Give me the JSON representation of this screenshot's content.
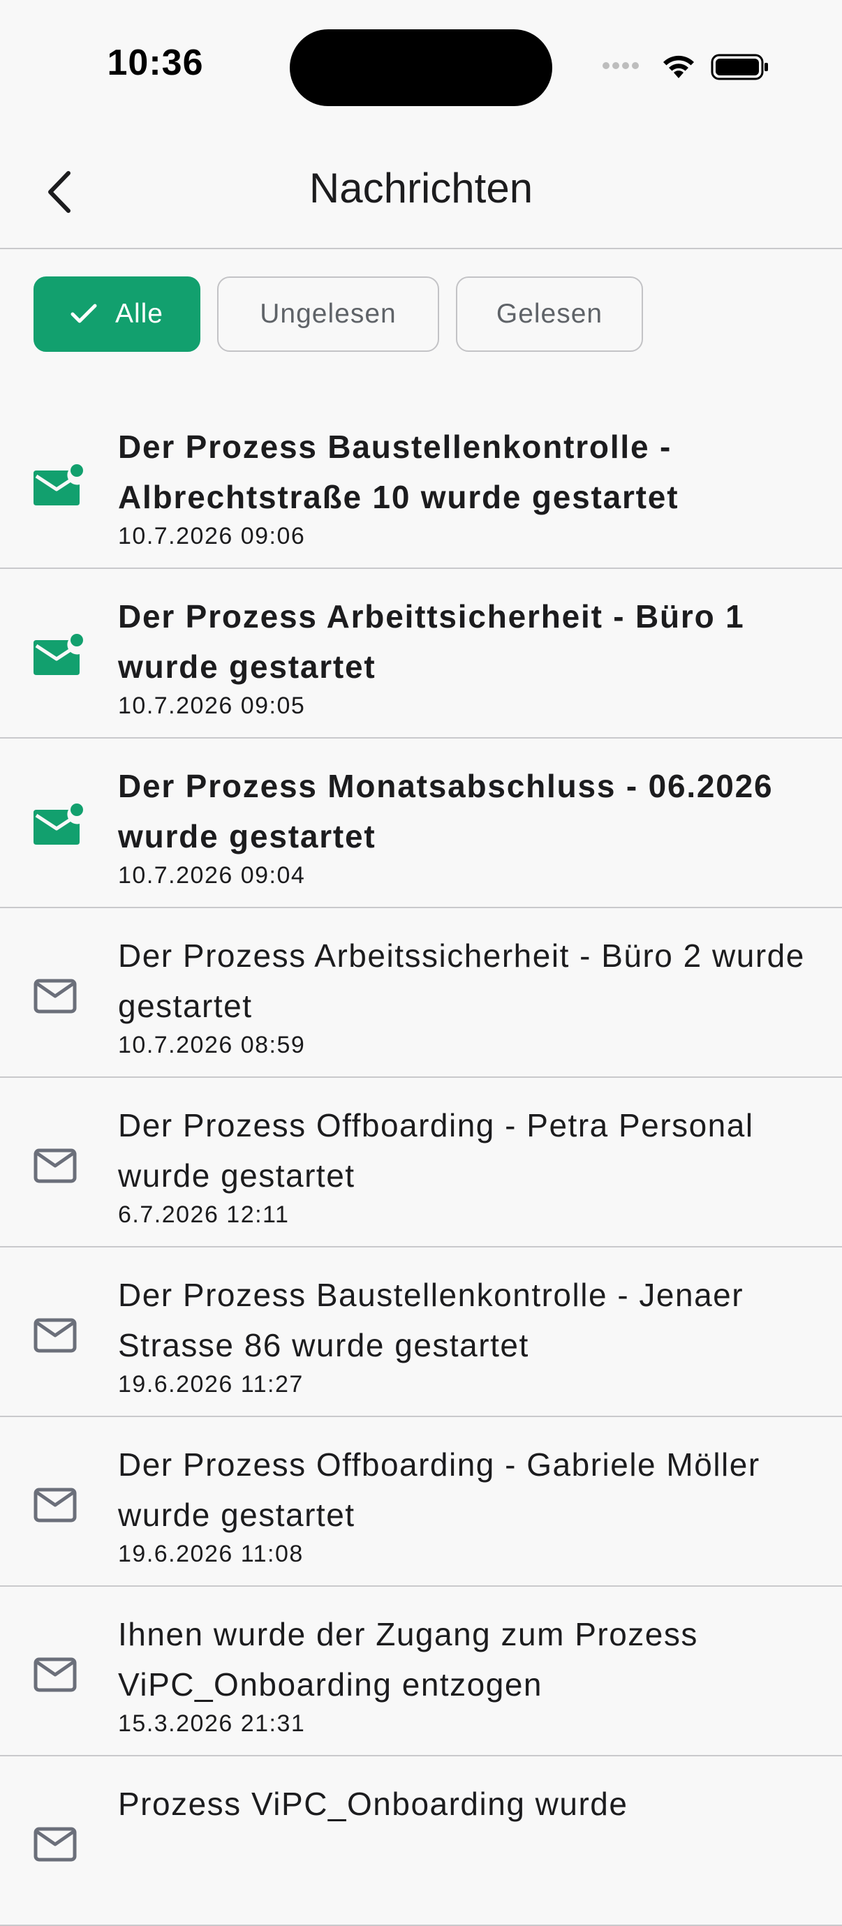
{
  "status_bar": {
    "time": "10:36"
  },
  "nav": {
    "title": "Nachrichten",
    "back_icon": "chevron-left-icon"
  },
  "filters": {
    "all_label": "Alle",
    "unread_label": "Ungelesen",
    "read_label": "Gelesen",
    "selected": "Alle",
    "accent_color": "#12a06e"
  },
  "messages": [
    {
      "title": "Der Prozess Baustellenkontrolle - Albrechtstraße 10 wurde gestartet",
      "date": "10.7.2026 09:06",
      "unread": true
    },
    {
      "title": "Der Prozess Arbeittsicherheit - Büro 1 wurde gestartet",
      "date": "10.7.2026 09:05",
      "unread": true
    },
    {
      "title": "Der Prozess Monatsabschluss - 06.2026 wurde gestartet",
      "date": "10.7.2026 09:04",
      "unread": true
    },
    {
      "title": "Der Prozess Arbeitssicherheit - Büro 2 wurde gestartet",
      "date": "10.7.2026 08:59",
      "unread": false
    },
    {
      "title": "Der Prozess Offboarding - Petra Personal wurde gestartet",
      "date": "6.7.2026 12:11",
      "unread": false
    },
    {
      "title": "Der Prozess Baustellenkontrolle - Jenaer Strasse 86 wurde gestartet",
      "date": "19.6.2026 11:27",
      "unread": false
    },
    {
      "title": "Der Prozess Offboarding - Gabriele Möller wurde gestartet",
      "date": "19.6.2026 11:08",
      "unread": false
    },
    {
      "title": "Ihnen wurde der Zugang zum Prozess ViPC_Onboarding entzogen",
      "date": "15.3.2026 21:31",
      "unread": false
    },
    {
      "title": "Prozess ViPC_Onboarding wurde",
      "date": "",
      "unread": false
    }
  ],
  "colors": {
    "unread_icon": "#12a06e",
    "read_icon": "#6b6f7a"
  }
}
